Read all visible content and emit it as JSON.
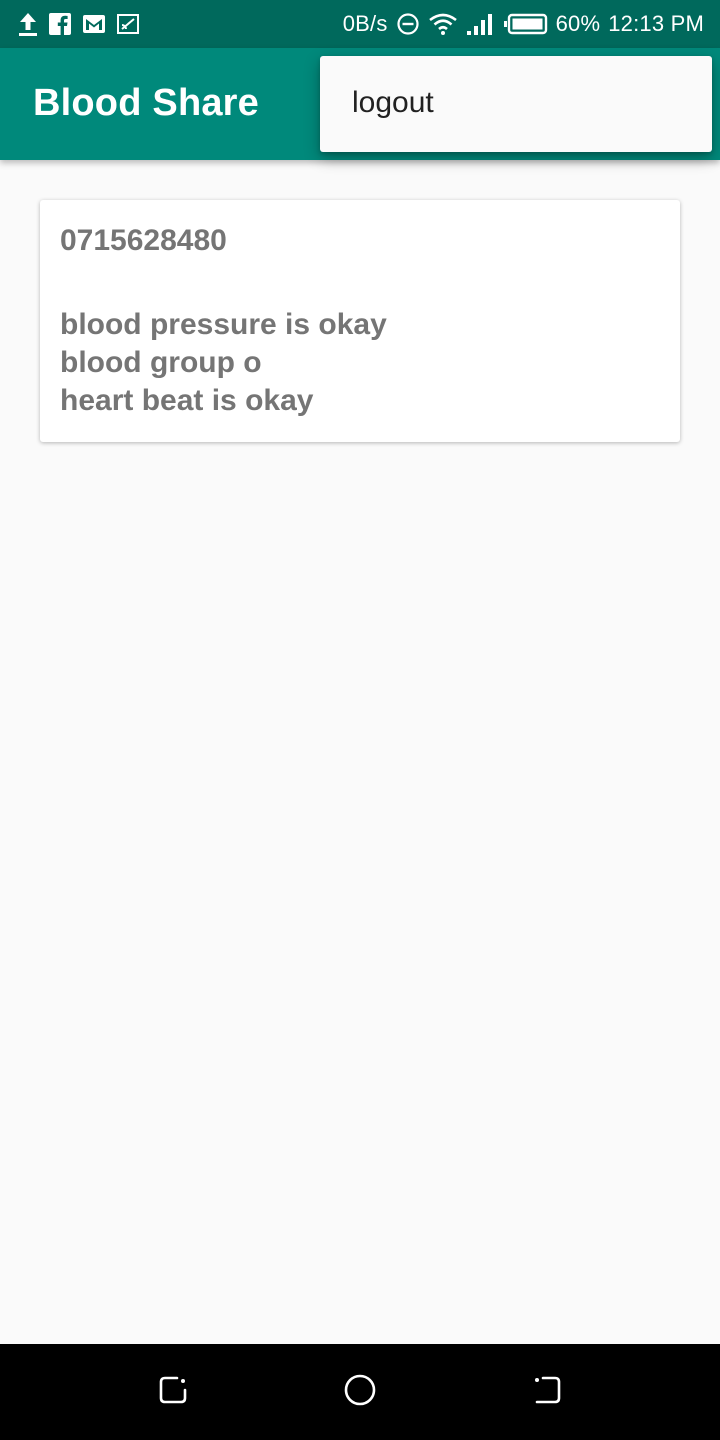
{
  "status_bar": {
    "net_speed": "0B/s",
    "battery": "60%",
    "time": "12:13 PM",
    "icons_left": [
      "upload-icon",
      "facebook-icon",
      "gmail-icon",
      "screencast-icon"
    ],
    "icons_right": [
      "dnd-icon",
      "wifi-icon",
      "signal-icon",
      "battery-icon"
    ]
  },
  "app_bar": {
    "title": "Blood Share"
  },
  "menu": {
    "items": [
      {
        "label": "logout"
      }
    ]
  },
  "card": {
    "phone": "0715628480",
    "lines": [
      "blood pressure is okay",
      "blood group o",
      "heart beat is okay"
    ]
  },
  "nav_bar": {
    "buttons": [
      "recents-icon",
      "home-icon",
      "back-icon"
    ]
  },
  "colors": {
    "status_bar": "#00695c",
    "app_bar": "#00897b",
    "text_gray": "#757575",
    "background": "#fafafa"
  }
}
